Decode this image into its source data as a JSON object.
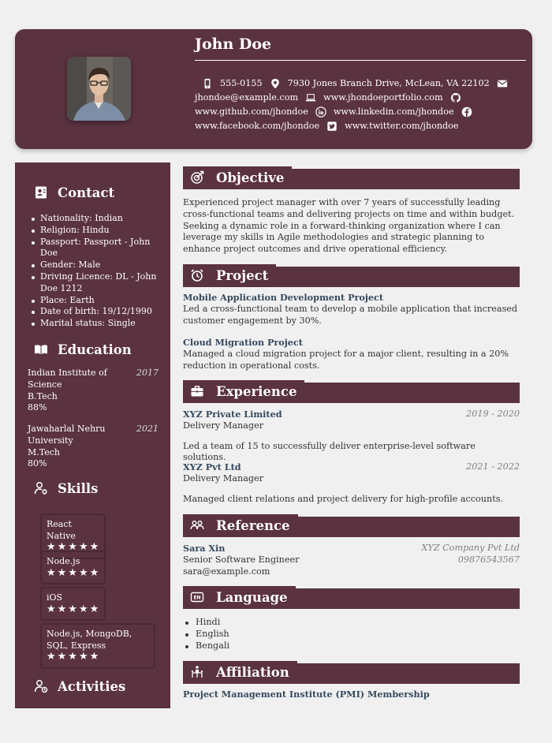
{
  "header": {
    "name": "John Doe",
    "phone": "555-0155",
    "address": "7930 Jones Branch Drive, McLean, VA 22102",
    "email": "jhondoe@example.com",
    "portfolio": "www.jhondoeportfolio.com",
    "github": "www.github.com/jhondoe",
    "linkedin": "www.linkedin.com/jhondoe",
    "facebook": "www.facebook.com/jhondoe",
    "twitter": "www.twitter.com/jhondoe"
  },
  "sidebar": {
    "contact_heading": "Contact",
    "contact_items": [
      "Nationality: Indian",
      "Religion: Hindu",
      "Passport: Passport - John Doe",
      "Gender: Male",
      "Driving Licence: DL - John Doe 1212",
      "Place: Earth",
      "Date of birth: 19/12/1990",
      "Marital status: Single"
    ],
    "education_heading": "Education",
    "education": [
      {
        "institution": "Indian Institute of Science",
        "degree": "B.Tech",
        "score": "88%",
        "year": "2017"
      },
      {
        "institution": "Jawaharlal Nehru University",
        "degree": "M.Tech",
        "score": "80%",
        "year": "2021"
      }
    ],
    "skills_heading": "Skills",
    "skills": [
      {
        "name": "React Native",
        "stars": "★★★★★"
      },
      {
        "name": "Node.js",
        "stars": "★★★★★"
      },
      {
        "name": "iOS",
        "stars": "★★★★★"
      },
      {
        "name": "Node.js, MongoDB, SQL, Express",
        "stars": "★★★★★"
      }
    ],
    "activities_heading": "Activities"
  },
  "main": {
    "objective_heading": "Objective",
    "objective_text": "Experienced project manager with over 7 years of successfully leading cross-functional teams and delivering projects on time and within budget. Seeking a dynamic role in a forward-thinking organization where I can leverage my skills in Agile methodologies and strategic planning to enhance project outcomes and drive operational efficiency.",
    "project_heading": "Project",
    "projects": [
      {
        "title": "Mobile Application Development Project",
        "desc": "Led a cross-functional team to develop a mobile application that increased customer engagement by 30%."
      },
      {
        "title": "Cloud Migration Project",
        "desc": "Managed a cloud migration project for a major client, resulting in a 20% reduction in operational costs."
      }
    ],
    "experience_heading": "Experience",
    "experience": [
      {
        "company": "XYZ Private Limited",
        "role": "Delivery Manager",
        "dates": "2019 - 2020",
        "desc": "Led a team of 15 to successfully deliver enterprise-level software solutions."
      },
      {
        "company": "XYZ Pvt Ltd",
        "role": "Delivery Manager",
        "dates": "2021 - 2022",
        "desc": "Managed client relations and project delivery for high-profile accounts."
      }
    ],
    "reference_heading": "Reference",
    "reference": {
      "name": "Sara Xin",
      "title": "Senior Software Engineer",
      "email": "sara@example.com",
      "company": "XYZ Company Pvt Ltd",
      "phone": "09876543567"
    },
    "language_heading": "Language",
    "languages": [
      "Hindi",
      "English",
      "Bengali"
    ],
    "affiliation_heading": "Affiliation",
    "affiliation": "Project Management Institute (PMI) Membership"
  },
  "colors": {
    "accent": "#5a3240",
    "background": "#f0f0f0",
    "title_text": "#34495e"
  }
}
